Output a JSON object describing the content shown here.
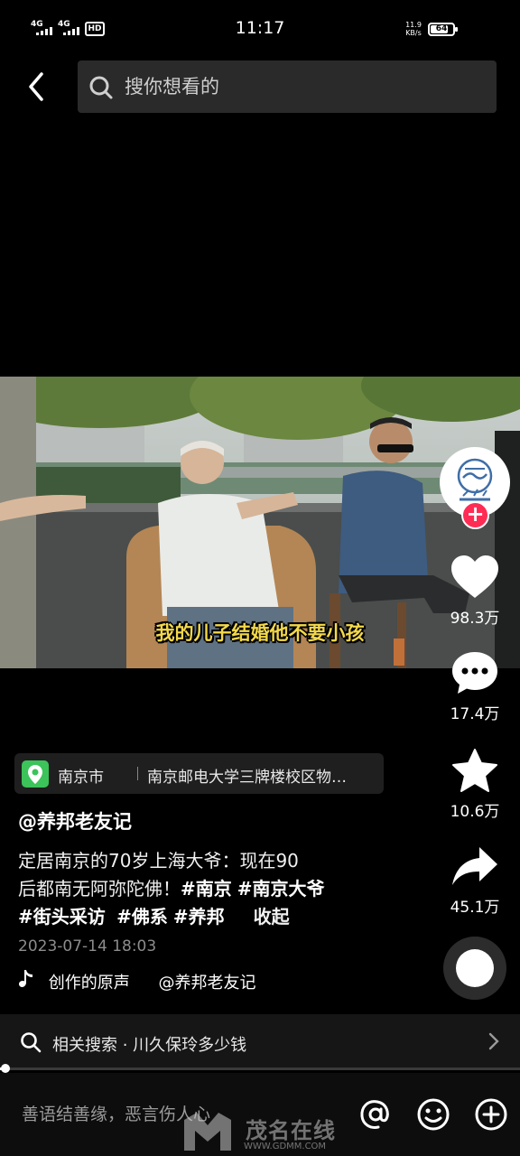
{
  "status_bar": {
    "net1": "4G",
    "net2": "4G",
    "hd": "HD",
    "time": "11:17",
    "speed_value": "11.9",
    "speed_unit": "KB/s",
    "battery": "64"
  },
  "header": {
    "search_placeholder": "搜你想看的"
  },
  "video": {
    "subtitle": "我的儿子结婚他不要小孩"
  },
  "actions": {
    "like_count": "98.3万",
    "comment_count": "17.4万",
    "favorite_count": "10.6万",
    "share_count": "45.1万"
  },
  "location": {
    "city": "南京市",
    "place": "南京邮电大学三牌楼校区物…"
  },
  "post": {
    "author": "@养邦老友记",
    "desc_line1": "定居南京的70岁上海大爷：现在90",
    "desc_line2_text": "后都南无阿弥陀佛！",
    "tags": [
      "#南京",
      "#南京大爷",
      "#街头采访",
      "#佛系",
      "#养邦"
    ],
    "fold": "收起",
    "date": "2023-07-14 18:03",
    "music_title": "创作的原声",
    "music_author": "@养邦老友记"
  },
  "related": {
    "label": "相关搜索 · 川久保玲多少钱"
  },
  "comment_bar": {
    "placeholder": "善语结善缘，恶言伤人心",
    "watermark": "茂名在线",
    "watermark_url": "WWW.GDMM.COM"
  },
  "colors": {
    "accent_red": "#fe2c55",
    "subtitle_yellow": "#f2d84b",
    "location_green": "#3cc35a"
  }
}
